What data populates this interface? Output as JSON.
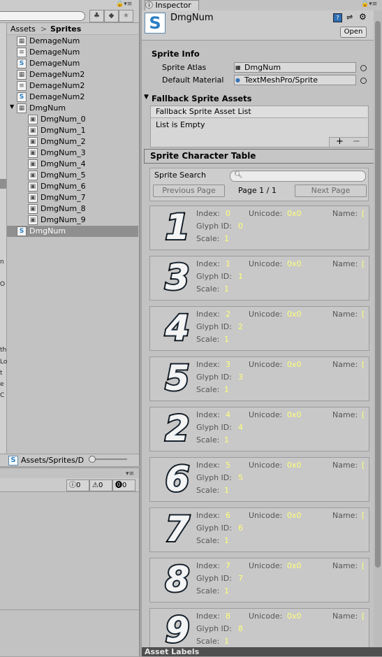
{
  "project": {
    "breadcrumb": [
      "Assets",
      ">",
      "Sprites"
    ],
    "items": [
      {
        "icon": "sprite-sheet-icon",
        "glyph": "▦",
        "label": "DemageNum",
        "indent": 0,
        "selected": false
      },
      {
        "icon": "document-icon",
        "glyph": "≡",
        "label": "DemageNum",
        "indent": 0,
        "selected": false
      },
      {
        "icon": "sprite-asset-icon",
        "glyph": "S",
        "label": "DemageNum",
        "indent": 0,
        "selected": false
      },
      {
        "icon": "sprite-sheet-icon",
        "glyph": "▦",
        "label": "DemageNum2",
        "indent": 0,
        "selected": false
      },
      {
        "icon": "document-icon",
        "glyph": "≡",
        "label": "DemageNum2",
        "indent": 0,
        "selected": false
      },
      {
        "icon": "sprite-asset-icon",
        "glyph": "S",
        "label": "DemageNum2",
        "indent": 0,
        "selected": false
      },
      {
        "icon": "sprite-sheet-icon",
        "glyph": "▦",
        "label": "DmgNum",
        "indent": 0,
        "selected": false,
        "expanded": true
      },
      {
        "icon": "sprite-icon",
        "glyph": "▣",
        "label": "DmgNum_0",
        "indent": 1,
        "selected": false
      },
      {
        "icon": "sprite-icon",
        "glyph": "▣",
        "label": "DmgNum_1",
        "indent": 1,
        "selected": false
      },
      {
        "icon": "sprite-icon",
        "glyph": "▣",
        "label": "DmgNum_2",
        "indent": 1,
        "selected": false
      },
      {
        "icon": "sprite-icon",
        "glyph": "▣",
        "label": "DmgNum_3",
        "indent": 1,
        "selected": false
      },
      {
        "icon": "sprite-icon",
        "glyph": "▣",
        "label": "DmgNum_4",
        "indent": 1,
        "selected": false
      },
      {
        "icon": "sprite-icon",
        "glyph": "▣",
        "label": "DmgNum_5",
        "indent": 1,
        "selected": false
      },
      {
        "icon": "sprite-icon",
        "glyph": "▣",
        "label": "DmgNum_6",
        "indent": 1,
        "selected": false
      },
      {
        "icon": "sprite-icon",
        "glyph": "▣",
        "label": "DmgNum_7",
        "indent": 1,
        "selected": false
      },
      {
        "icon": "sprite-icon",
        "glyph": "▣",
        "label": "DmgNum_8",
        "indent": 1,
        "selected": false
      },
      {
        "icon": "sprite-icon",
        "glyph": "▣",
        "label": "DmgNum_9",
        "indent": 1,
        "selected": false
      },
      {
        "icon": "sprite-asset-icon",
        "glyph": "S",
        "label": "DmgNum",
        "indent": 0,
        "selected": true
      }
    ],
    "footer_path": "Assets/Sprites/D",
    "left_strip_letters": [
      "n",
      "O",
      "th",
      "Lo",
      "t",
      "e",
      "C"
    ]
  },
  "console": {
    "info_count": "0",
    "warn_count": "0",
    "error_count": "0"
  },
  "inspector": {
    "tab_label": "Inspector",
    "asset_name": "DmgNum",
    "asset_icon_glyph": "S",
    "open_label": "Open",
    "sprite_info_heading": "Sprite Info",
    "sprite_atlas_label": "Sprite Atlas",
    "sprite_atlas_value": "DmgNum",
    "default_material_label": "Default Material",
    "default_material_value": "TextMeshPro/Sprite",
    "fallback_heading": "Fallback Sprite Assets",
    "fallback_list_header": "Fallback Sprite Asset List",
    "fallback_list_empty": "List is Empty",
    "plus": "+",
    "minus": "−",
    "char_table_heading": "Sprite Character Table",
    "sprite_search_label": "Sprite Search",
    "search_placeholder": "",
    "previous_page": "Previous Page",
    "page_indicator": "Page 1 / 1",
    "next_page": "Next Page",
    "labels": {
      "index": "Index:",
      "unicode": "Unicode:",
      "name": "Name:",
      "glyph_id": "Glyph ID:",
      "scale": "Scale:"
    },
    "characters": [
      {
        "glyph": "1",
        "index": "0",
        "unicode": "0x0",
        "name": "[",
        "glyph_id": "0",
        "scale": "1"
      },
      {
        "glyph": "3",
        "index": "1",
        "unicode": "0x0",
        "name": "[",
        "glyph_id": "1",
        "scale": "1"
      },
      {
        "glyph": "4",
        "index": "2",
        "unicode": "0x0",
        "name": "[",
        "glyph_id": "2",
        "scale": "1"
      },
      {
        "glyph": "5",
        "index": "3",
        "unicode": "0x0",
        "name": "[",
        "glyph_id": "3",
        "scale": "1"
      },
      {
        "glyph": "2",
        "index": "4",
        "unicode": "0x0",
        "name": "[",
        "glyph_id": "4",
        "scale": "1"
      },
      {
        "glyph": "6",
        "index": "5",
        "unicode": "0x0",
        "name": "[",
        "glyph_id": "5",
        "scale": "1"
      },
      {
        "glyph": "7",
        "index": "6",
        "unicode": "0x0",
        "name": "[",
        "glyph_id": "6",
        "scale": "1"
      },
      {
        "glyph": "8",
        "index": "7",
        "unicode": "0x0",
        "name": "[",
        "glyph_id": "7",
        "scale": "1"
      },
      {
        "glyph": "9",
        "index": "8",
        "unicode": "0x0",
        "name": "[",
        "glyph_id": "8",
        "scale": "1"
      }
    ],
    "asset_labels": "Asset Labels"
  },
  "colors": {
    "panel": "#c2c2c2",
    "selection": "#8f8f8f",
    "value_yellow": "#ffff7a",
    "accent_blue": "#2a7fc4"
  }
}
